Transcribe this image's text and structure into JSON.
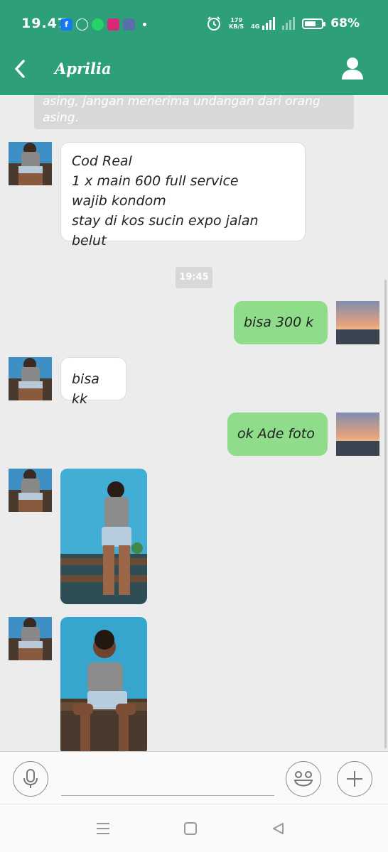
{
  "status_bar": {
    "time": "19.47",
    "network_speed_value": "179",
    "network_speed_unit": "KB/S",
    "network_type": "4G",
    "battery_text": "68%",
    "battery_level": 0.68
  },
  "app_bar": {
    "contact_name": "Aprilia"
  },
  "chat": {
    "system_note": "asing, jangan menerima undangan dari orang asing.",
    "messages": [
      {
        "direction": "incoming",
        "lines": [
          "Cod Real",
          "1 x main 600 full service",
          "wajib kondom",
          "stay di kos sucin expo jalan belut"
        ]
      },
      {
        "timestamp": "19:45"
      },
      {
        "direction": "outgoing",
        "text": "bisa 300 k"
      },
      {
        "direction": "incoming",
        "text": "bisa kk"
      },
      {
        "direction": "outgoing",
        "text": "ok Ade foto"
      },
      {
        "direction": "incoming",
        "type": "photo",
        "description": "woman standing facing wall"
      },
      {
        "direction": "incoming",
        "type": "photo",
        "description": "woman sitting on bench"
      }
    ]
  },
  "colors": {
    "header": "#2e9f7b",
    "outgoing_bubble": "#8fdc8a",
    "incoming_bubble": "#ffffff",
    "chat_background": "#ececec"
  },
  "icons": {
    "back": "chevron-left-icon",
    "profile": "person-icon",
    "mic": "microphone-icon",
    "emoji": "smiley-icon",
    "attach": "plus-icon"
  }
}
